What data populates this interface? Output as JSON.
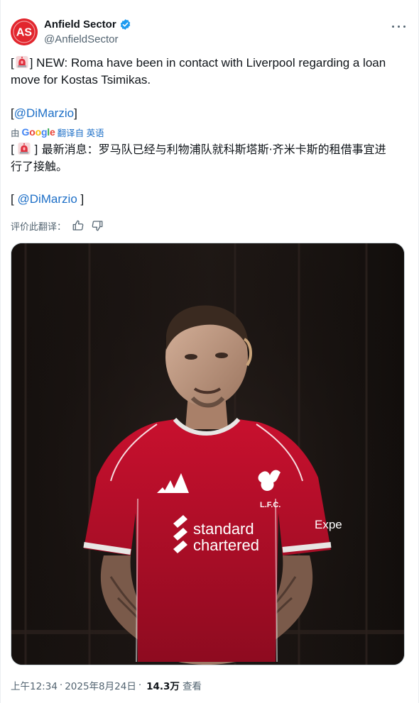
{
  "account": {
    "display_name": "Anfield Sector",
    "handle": "@AnfieldSector",
    "avatar_text": "AS",
    "verified": true
  },
  "tweet": {
    "en_line1": "] NEW: Roma have been in contact with Liverpool regarding a loan",
    "en_line2": "move for Kostas Tsimikas.",
    "bracket_open": "[",
    "mention_open": "[",
    "mention": "@DiMarzio",
    "mention_close": "]"
  },
  "translation": {
    "prefix": "由",
    "provider": "Google",
    "label": "翻译自 英语",
    "zh_bracket_open": "[",
    "zh_line1": "] 最新消息：罗马队已经与利物浦队就科斯塔斯·齐米卡斯的租借事宜进",
    "zh_line2": "行了接触。",
    "zh_mention_open": "[ ",
    "zh_mention": "@DiMarzio",
    "zh_mention_close": " ]",
    "rate_label": "评价此翻译："
  },
  "media": {
    "jersey_sponsor_line1": "standard",
    "jersey_sponsor_line2": "chartered",
    "crest_text": "L.F.C.",
    "sleeve_text": "Expe"
  },
  "meta": {
    "time": "上午12:34",
    "date": "2025年8月24日",
    "separator": "·",
    "views_count": "14.3万",
    "views_label": "查看"
  },
  "icons": {
    "more": "more-icon",
    "verified": "verified-badge-icon",
    "siren": "siren-emoji-icon",
    "thumbs_up": "thumbs-up-icon",
    "thumbs_down": "thumbs-down-icon"
  },
  "colors": {
    "avatar_bg": "#e2262e",
    "verified": "#1d9bf0",
    "link": "#1d6fc7",
    "muted": "#536471",
    "jersey": "#c8102e"
  }
}
